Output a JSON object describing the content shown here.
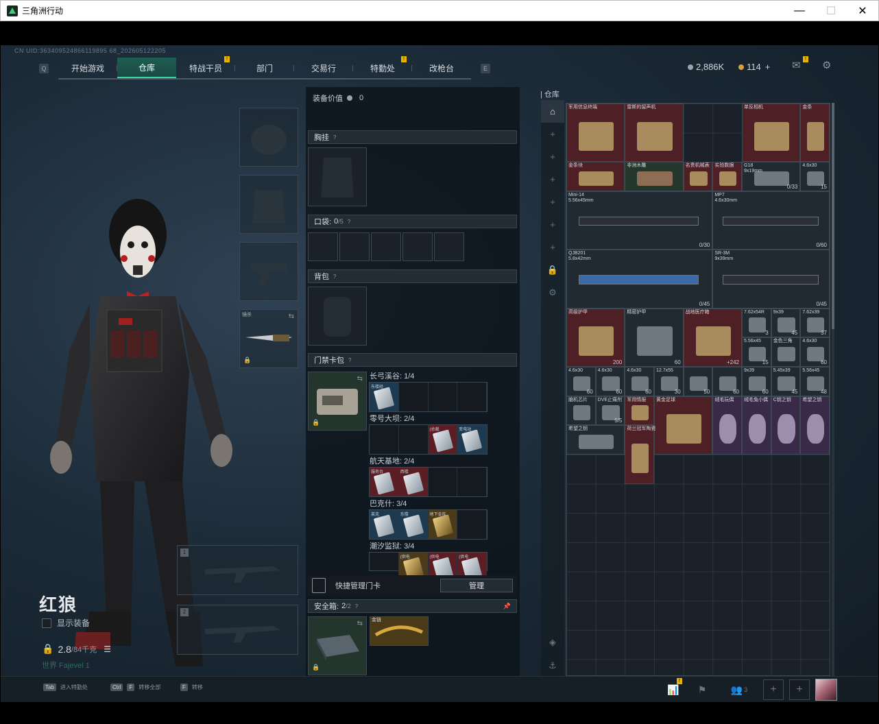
{
  "window": {
    "title": "三角洲行动",
    "minimize": "—",
    "maximize": "☐",
    "close": "✕"
  },
  "uid": "CN UID:363409524866119895 68_202605122205",
  "nav": {
    "left_key": "Q",
    "right_key": "E",
    "tabs": [
      {
        "label": "开始游戏",
        "active": false,
        "alert": false
      },
      {
        "label": "仓库",
        "active": true,
        "alert": false
      },
      {
        "label": "特战干员",
        "active": false,
        "alert": true
      },
      {
        "label": "部门",
        "active": false,
        "alert": false
      },
      {
        "label": "交易行",
        "active": false,
        "alert": false
      },
      {
        "label": "特勤处",
        "active": false,
        "alert": true
      },
      {
        "label": "改枪台",
        "active": false,
        "alert": false
      }
    ],
    "alert_mark": "!"
  },
  "currency": {
    "silver": "2,886K",
    "gold": "114",
    "gold_plus": "+",
    "silver_color": "#9aa4ae",
    "gold_color": "#d8a040"
  },
  "character": {
    "name": "红狼",
    "show_equipment": "显示装备",
    "weight": "2.8",
    "weight_max": "/84千克",
    "rank": "世界 Fajevel 1"
  },
  "slots": {
    "melee_label": "镜杀",
    "weapon1_num": "1",
    "weapon2_num": "2",
    "lock": "🔒",
    "swap": "⇆"
  },
  "equipment": {
    "value_label": "装备价值",
    "value": "0",
    "chest_rig": "胸挂",
    "pocket_label": "口袋:",
    "pocket_count": "0",
    "pocket_max": "/5",
    "backpack": "背包",
    "keycard_bag": "门禁卡包",
    "maps": [
      {
        "name": "长弓溪谷: 1/4",
        "cells": [
          {
            "label": "东楼经",
            "style": "blue"
          },
          {
            "label": "",
            "style": ""
          },
          {
            "label": "",
            "style": ""
          },
          {
            "label": "",
            "style": ""
          }
        ]
      },
      {
        "name": "零号大坝: 2/4",
        "cells": [
          {
            "label": "",
            "style": ""
          },
          {
            "label": "",
            "style": ""
          },
          {
            "label": "(总裁",
            "style": "red"
          },
          {
            "label": "变电站",
            "style": "blue"
          }
        ]
      },
      {
        "name": "航天基地: 2/4",
        "cells": [
          {
            "label": "服务台",
            "style": "red"
          },
          {
            "label": "西楼",
            "style": "red"
          },
          {
            "label": "",
            "style": ""
          },
          {
            "label": "",
            "style": ""
          }
        ]
      },
      {
        "name": "巴克什: 3/4",
        "cells": [
          {
            "label": "莱克",
            "style": "blue"
          },
          {
            "label": "东楼",
            "style": "blue"
          },
          {
            "label": "地下金库",
            "style": "gold"
          },
          {
            "label": "",
            "style": ""
          }
        ]
      },
      {
        "name": "潮汐监狱: 3/4",
        "cells": [
          {
            "label": "",
            "style": ""
          },
          {
            "label": "(供电",
            "style": "gold"
          },
          {
            "label": "(供电",
            "style": "red"
          },
          {
            "label": "(供电",
            "style": "red"
          }
        ]
      }
    ],
    "quick_manage": "快捷管理门卡",
    "manage_btn": "管理",
    "safe_box_label": "安全箱:",
    "safe_box_count": "2",
    "safe_box_max": "/2",
    "safe_item": "金链",
    "pin": "📌",
    "question": "?"
  },
  "warehouse": {
    "title": "仓库",
    "side_buttons": [
      "⌂",
      "+",
      "+",
      "+",
      "+",
      "+",
      "+",
      "🔒",
      "⚙"
    ],
    "bottom_buttons": [
      "◈",
      "⚓"
    ],
    "items": [
      {
        "name": "军用信息终端",
        "count": "",
        "style": "red"
      },
      {
        "name": "雷斯的留声机",
        "count": "",
        "style": "red"
      },
      {
        "name": "单反相机",
        "count": "",
        "style": "red"
      },
      {
        "name": "金条",
        "count": "",
        "style": "red"
      },
      {
        "name": "金条块",
        "count": "",
        "style": "red"
      },
      {
        "name": "非洲木雕",
        "count": "",
        "style": "green"
      },
      {
        "name": "名贵机械表",
        "count": "",
        "style": "red"
      },
      {
        "name": "实验数据",
        "count": "",
        "style": "red"
      },
      {
        "name": "G18\n9x19mm",
        "count": "0/33",
        "style": "dark"
      },
      {
        "name": "4.6x30",
        "count": "15",
        "style": "dark"
      },
      {
        "name": "Mini-14\n5.56x45mm",
        "count": "0/30",
        "style": "dark"
      },
      {
        "name": "MP7\n4.6x30mm",
        "count": "0/60",
        "style": "dark"
      },
      {
        "name": "QJB201\n5.8x42mm",
        "count": "0/45",
        "style": "dark"
      },
      {
        "name": "SR-3M\n9x39mm",
        "count": "0/45",
        "style": "dark"
      },
      {
        "name": "高级护甲",
        "count": "200",
        "style": "red"
      },
      {
        "name": "精密护甲",
        "count": "60",
        "style": "dark"
      },
      {
        "name": "战地医疗箱",
        "count": "+242",
        "style": "red"
      },
      {
        "name": "7.62x54R",
        "count": "3",
        "style": "dark"
      },
      {
        "name": "9x39",
        "count": "45",
        "style": "dark"
      },
      {
        "name": "7.62x39",
        "count": "37",
        "style": "dark"
      },
      {
        "name": "5.56x45",
        "count": "15",
        "style": "dark"
      },
      {
        "name": "金色三角",
        "count": "",
        "style": "dark"
      },
      {
        "name": "4.6x30",
        "count": "60",
        "style": "dark"
      },
      {
        "name": "4.6x30",
        "count": "60",
        "style": "dark"
      },
      {
        "name": "4.6x30",
        "count": "60",
        "style": "dark"
      },
      {
        "name": "4.6x30",
        "count": "60",
        "style": "dark"
      },
      {
        "name": "12.7x55",
        "count": "30",
        "style": "dark"
      },
      {
        "name": "",
        "count": "50",
        "style": "dark"
      },
      {
        "name": "",
        "count": "60",
        "style": "dark"
      },
      {
        "name": "9x39",
        "count": "60",
        "style": "dark"
      },
      {
        "name": "5.45x39",
        "count": "45",
        "style": "dark"
      },
      {
        "name": "5.56x45",
        "count": "48",
        "style": "dark"
      },
      {
        "name": "脑机芯片",
        "count": "",
        "style": "dark"
      },
      {
        "name": "DVE止痛剂",
        "count": "5/5",
        "style": "dark"
      },
      {
        "name": "军用情报",
        "count": "",
        "style": "red"
      },
      {
        "name": "黄金足球",
        "count": "",
        "style": "red"
      },
      {
        "name": "绒毛玩偶",
        "count": "",
        "style": "purple"
      },
      {
        "name": "绒毛兔小偶",
        "count": "",
        "style": "purple"
      },
      {
        "name": "C钥之钥",
        "count": "",
        "style": "purple"
      },
      {
        "name": "希望之钥",
        "count": "",
        "style": "purple"
      },
      {
        "name": "希望之钥",
        "count": "",
        "style": "dark"
      },
      {
        "name": "荷兰冠军陶瓷",
        "count": "",
        "style": "red"
      }
    ]
  },
  "bottom_bar": {
    "hints": [
      {
        "key": "Tab",
        "label": "进入特勤处"
      },
      {
        "key": "Ctrl",
        "key2": "F",
        "label": "转移全部"
      },
      {
        "key": "F",
        "label": "转移"
      }
    ],
    "squad_count": "3",
    "icons": [
      "chart-icon",
      "flag-icon",
      "squad-icon"
    ]
  }
}
